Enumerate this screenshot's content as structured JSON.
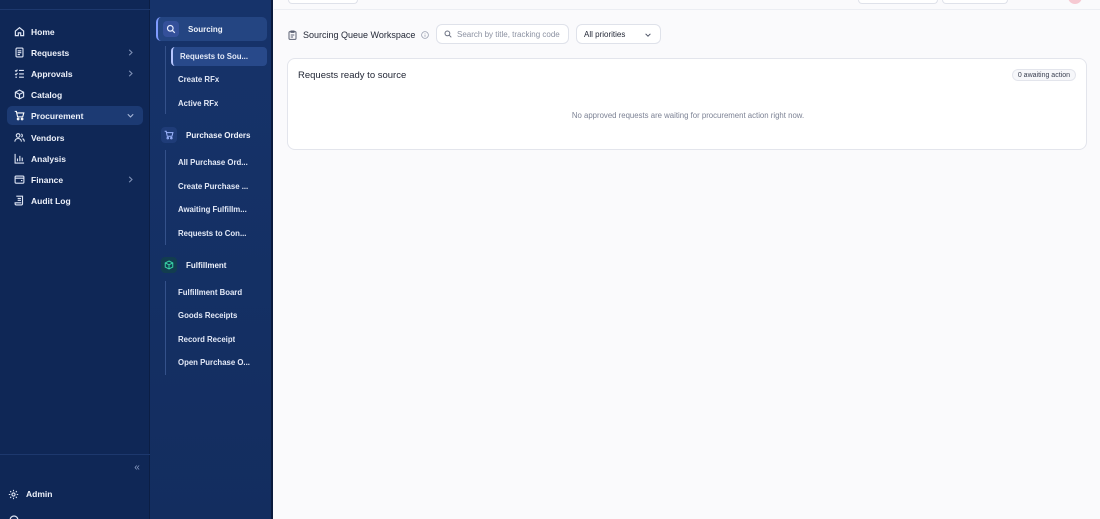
{
  "primary_nav": {
    "items": [
      {
        "label": "Home",
        "icon": "home-icon",
        "chevron": false,
        "active": false
      },
      {
        "label": "Requests",
        "icon": "document-icon",
        "chevron": true,
        "active": false
      },
      {
        "label": "Approvals",
        "icon": "checklist-icon",
        "chevron": true,
        "active": false
      },
      {
        "label": "Catalog",
        "icon": "box-icon",
        "chevron": false,
        "active": false
      },
      {
        "label": "Procurement",
        "icon": "cart-icon",
        "chevron": true,
        "active": true,
        "expanded": true
      },
      {
        "label": "Vendors",
        "icon": "users-icon",
        "chevron": false,
        "active": false
      },
      {
        "label": "Analysis",
        "icon": "bar-chart-icon",
        "chevron": false,
        "active": false
      },
      {
        "label": "Finance",
        "icon": "wallet-icon",
        "chevron": true,
        "active": false
      },
      {
        "label": "Audit Log",
        "icon": "scroll-icon",
        "chevron": false,
        "active": false
      }
    ],
    "collapse_glyph": "«",
    "admin_label": "Admin"
  },
  "secondary_nav": {
    "sourcing": {
      "label": "Sourcing",
      "icon": "search-icon",
      "items": [
        "Requests to Sou...",
        "Create RFx",
        "Active RFx"
      ]
    },
    "purchase_orders": {
      "label": "Purchase Orders",
      "icon": "cart-icon",
      "items": [
        "All Purchase Ord...",
        "Create Purchase ...",
        "Awaiting Fulfillm...",
        "Requests to Con..."
      ]
    },
    "fulfillment": {
      "label": "Fulfillment",
      "icon": "package-icon",
      "items": [
        "Fulfillment Board",
        "Goods Receipts",
        "Record Receipt",
        "Open Purchase O..."
      ]
    }
  },
  "toolbar": {
    "title": "Sourcing Queue Workspace",
    "search_placeholder": "Search by title, tracking code",
    "priority_selected": "All priorities"
  },
  "card": {
    "title": "Requests ready to source",
    "badge": "0 awaiting action",
    "empty_message": "No approved requests are waiting for procurement action right now."
  },
  "colors": {
    "sidebar_bg": "#0f2756",
    "secondary_bg": "#16336a",
    "accent": "#7f9bff",
    "fulfillment_icon_bg": "#123d4f"
  }
}
